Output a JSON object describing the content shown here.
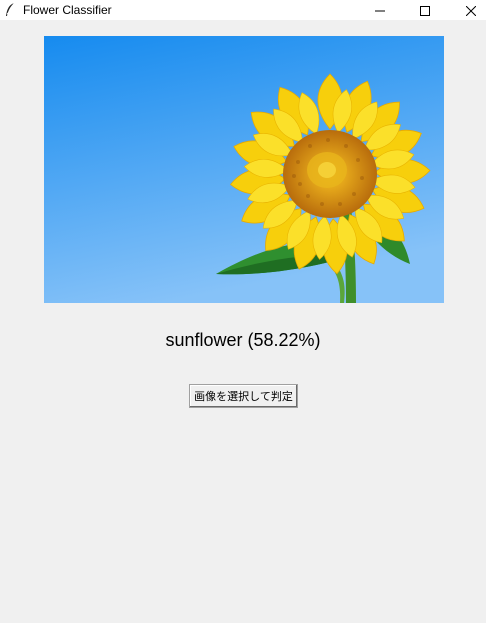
{
  "window": {
    "title": "Flower Classifier",
    "icon": "feather-icon",
    "controls": [
      "minimize-icon",
      "maximize-icon",
      "close-icon"
    ]
  },
  "image": {
    "subject": "sunflower photo"
  },
  "result": {
    "text": "sunflower (58.22%)"
  },
  "actions": {
    "select_button_label": "画像を選択して判定"
  },
  "colors": {
    "sky_top": "#1c8ff0",
    "sky_bottom": "#7fbdf8",
    "petal": "#f9d10a",
    "petal_dark": "#e8a800",
    "center": "#c07a10",
    "leaf": "#2e8b2e",
    "stem": "#3f8f2a",
    "background": "#f0f0f0"
  }
}
